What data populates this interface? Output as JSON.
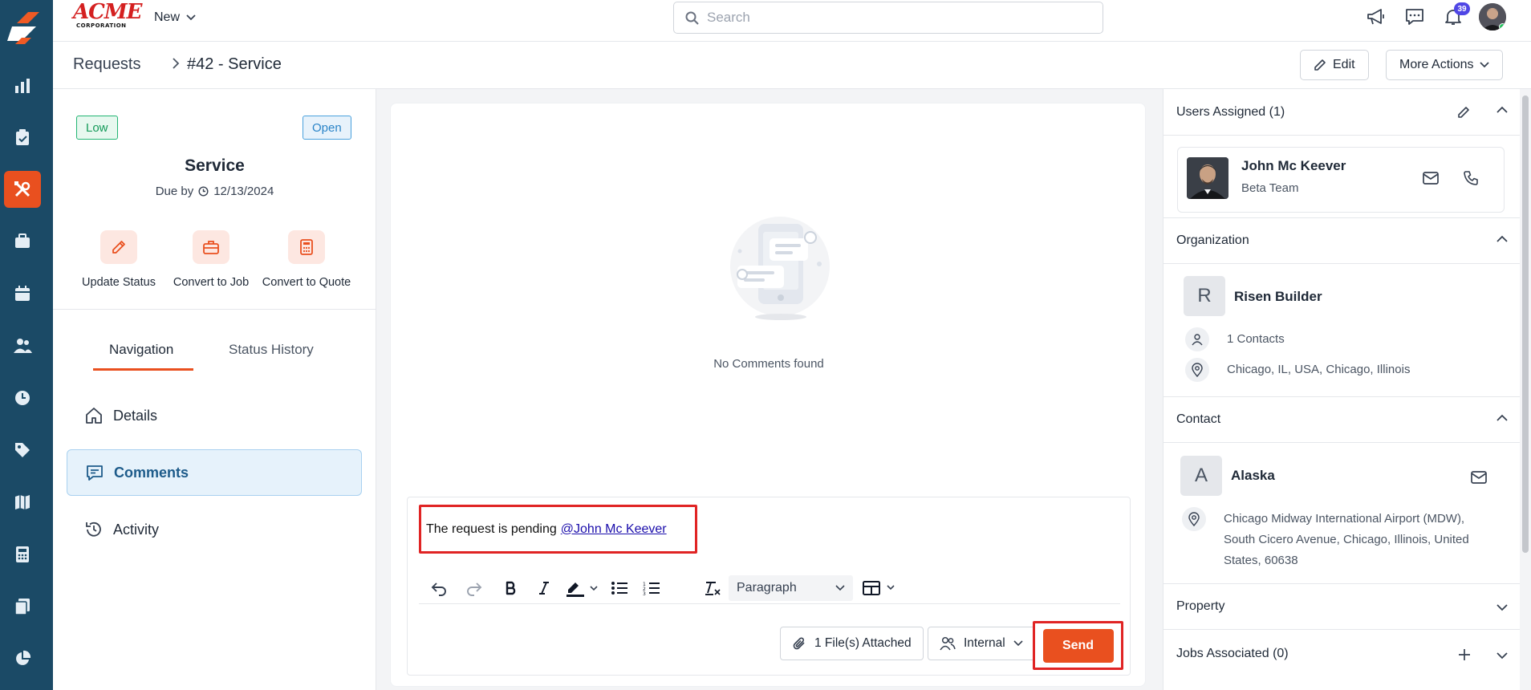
{
  "topbar": {
    "brand_big": "ACME",
    "brand_small": "CORPORATION",
    "new_label": "New",
    "search_placeholder": "Search",
    "notification_count": "39"
  },
  "breadcrumb": {
    "root": "Requests",
    "current": "#42 - Service",
    "edit_label": "Edit",
    "more_actions_label": "More Actions"
  },
  "request": {
    "priority": "Low",
    "status": "Open",
    "title": "Service",
    "due_label": "Due by",
    "due_date": "12/13/2024",
    "actions": [
      {
        "label": "Update Status",
        "icon": "pencil-icon"
      },
      {
        "label": "Convert to Job",
        "icon": "briefcase-icon"
      },
      {
        "label": "Convert to Quote",
        "icon": "calculator-icon"
      }
    ],
    "tabs": [
      "Navigation",
      "Status History"
    ],
    "nav": [
      {
        "label": "Details",
        "icon": "home-icon"
      },
      {
        "label": "Comments",
        "icon": "comment-icon"
      },
      {
        "label": "Activity",
        "icon": "history-icon"
      }
    ]
  },
  "comments": {
    "empty_text": "No Comments found",
    "draft_text": "The request is pending",
    "mention": "@John Mc Keever",
    "format_value": "Paragraph",
    "attached_label": "1 File(s) Attached",
    "visibility_label": "Internal",
    "send_label": "Send"
  },
  "sidebar": {
    "users_assigned": "Users Assigned (1)",
    "user": {
      "name": "John Mc Keever",
      "team": "Beta Team"
    },
    "organization_head": "Organization",
    "organization": {
      "initial": "R",
      "name": "Risen Builder",
      "contacts": "1 Contacts",
      "location": "Chicago, IL, USA, Chicago, Illinois"
    },
    "contact_head": "Contact",
    "contact": {
      "initial": "A",
      "name": "Alaska",
      "address_line1": "Chicago Midway International Airport (MDW),",
      "address_line2": "South Cicero Avenue, Chicago, Illinois, United",
      "address_line3": "States, 60638"
    },
    "property_head": "Property",
    "jobs_head": "Jobs Associated (0)"
  },
  "colors": {
    "rail": "#1b4a66",
    "accent": "#e9501f",
    "highlight": "#e02424"
  }
}
